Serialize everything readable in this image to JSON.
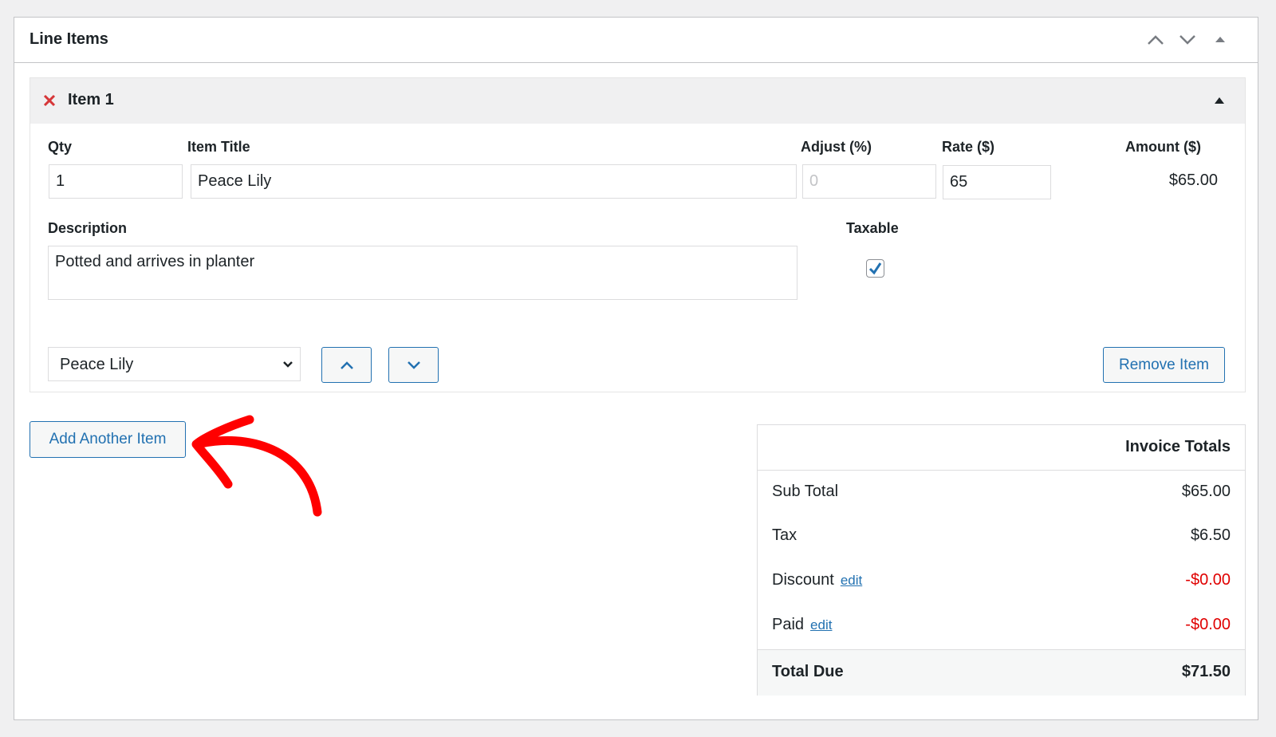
{
  "panel": {
    "title": "Line Items",
    "controls": [
      "move-up-icon",
      "move-down-icon",
      "collapse-icon"
    ]
  },
  "item": {
    "title": "Item 1",
    "labels": {
      "qty": "Qty",
      "item_title": "Item Title",
      "adjust": "Adjust (%)",
      "rate": "Rate ($)",
      "amount": "Amount ($)",
      "description": "Description",
      "taxable": "Taxable"
    },
    "values": {
      "qty": "1",
      "item_title": "Peace Lily",
      "adjust_placeholder": "0",
      "rate": "65",
      "amount": "$65.00",
      "description": "Potted and arrives in planter",
      "taxable": true
    },
    "product_select": "Peace Lily",
    "remove_label": "Remove Item"
  },
  "add_item_label": "Add Another Item",
  "totals": {
    "title": "Invoice Totals",
    "rows": [
      {
        "label": "Sub Total",
        "value": "$65.00"
      },
      {
        "label": "Tax",
        "value": "$6.50"
      },
      {
        "label": "Discount",
        "edit": "edit",
        "value": "-$0.00"
      },
      {
        "label": "Paid",
        "edit": "edit",
        "value": "-$0.00"
      }
    ],
    "total_label": "Total Due",
    "total_value": "$71.50"
  },
  "colors": {
    "accent": "#2271b1",
    "negative": "#e00000",
    "remove": "#d63638",
    "annotation": "#ff0000"
  }
}
